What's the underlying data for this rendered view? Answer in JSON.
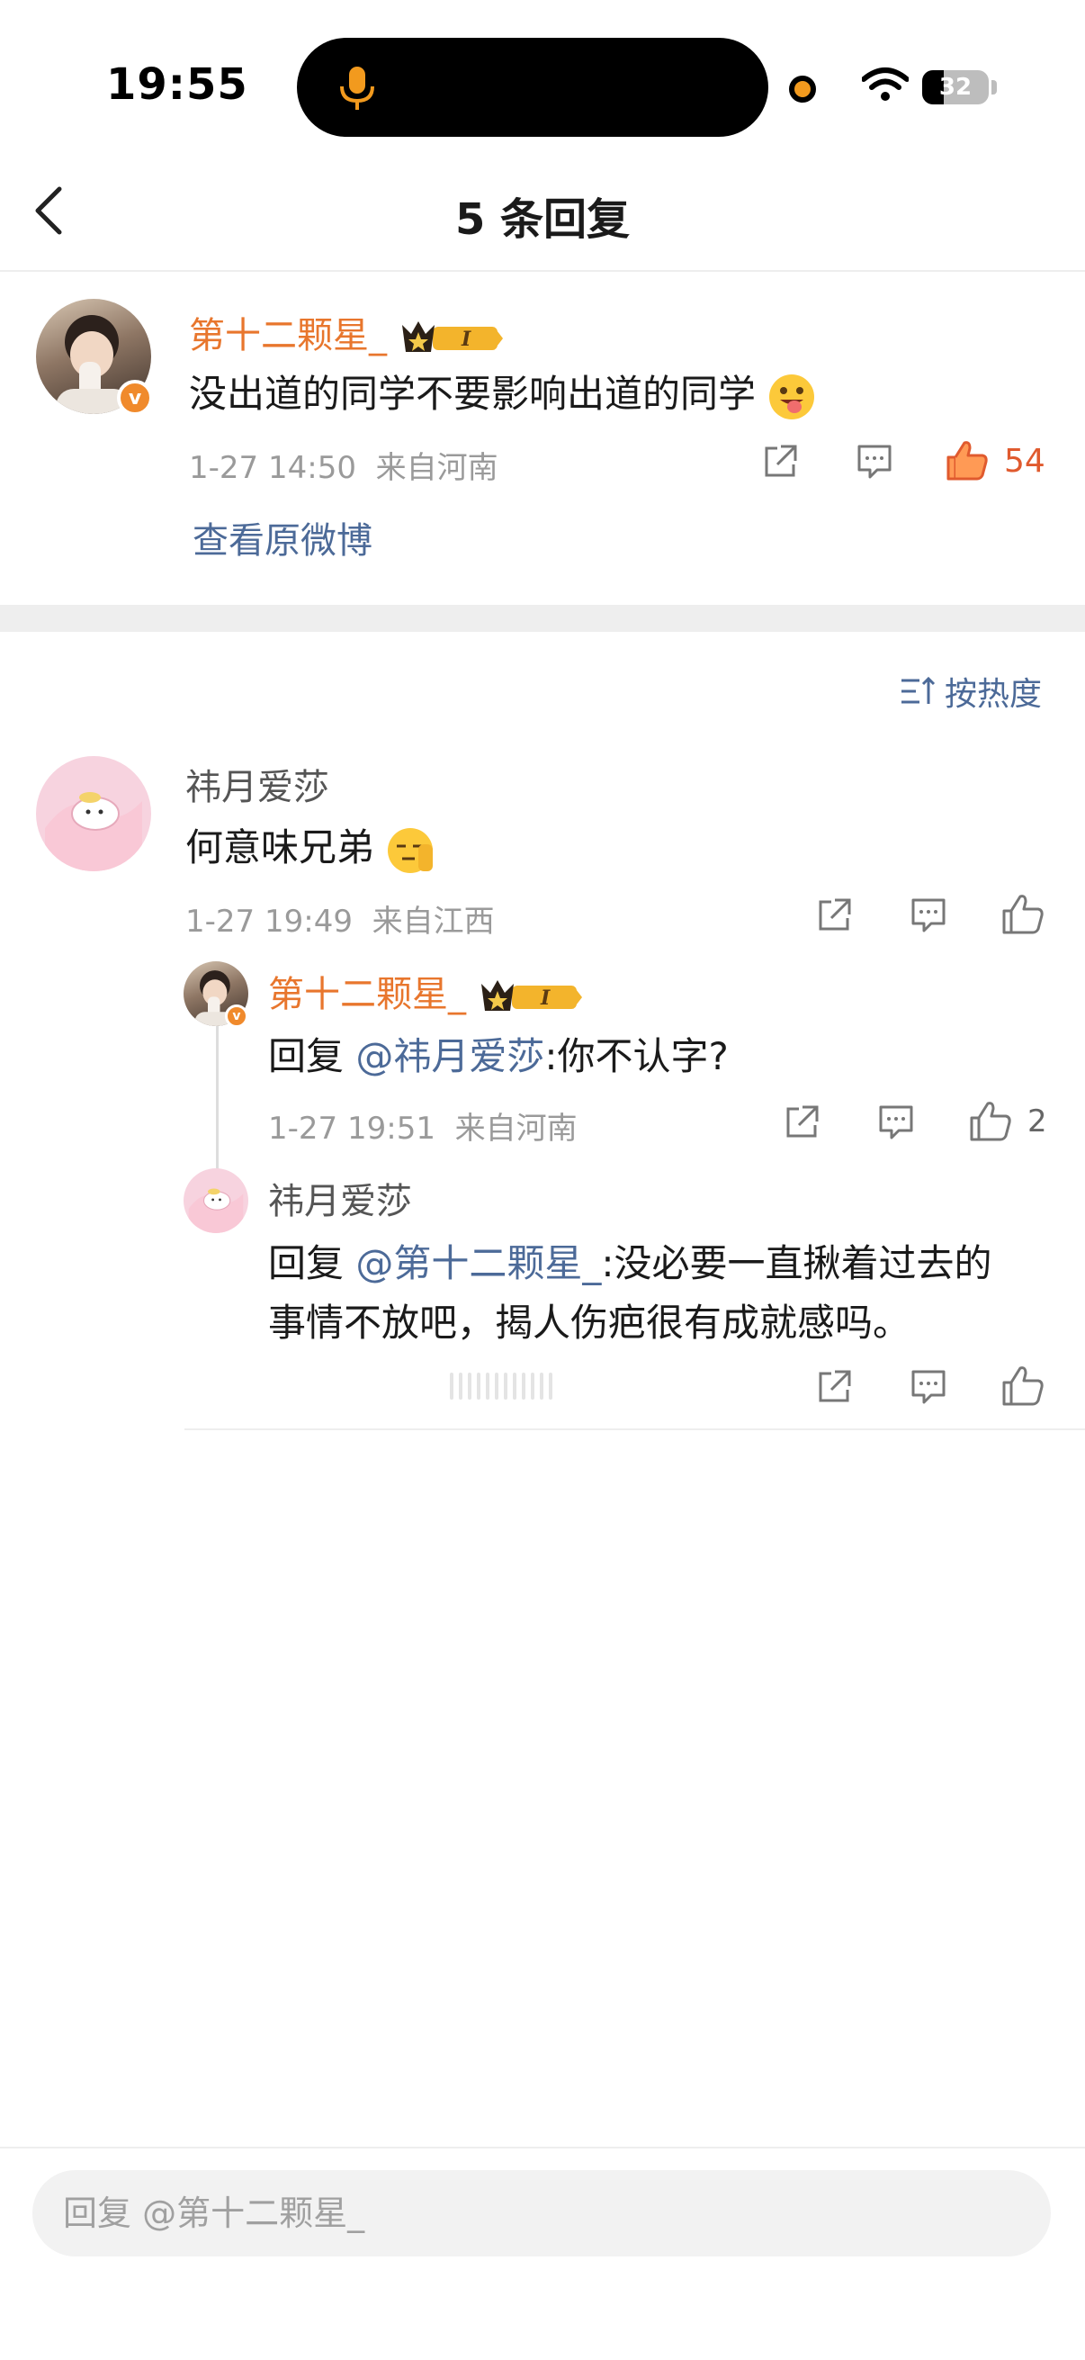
{
  "status_bar": {
    "time": "19:55",
    "battery_level": "32",
    "battery_fraction": 0.32
  },
  "nav": {
    "title": "5 条回复"
  },
  "post": {
    "username": "第十二颗星_",
    "text": "没出道的同学不要影响出道的同学",
    "date": "1-27 14:50",
    "location": "来自河南",
    "like_count": "54",
    "view_original": "查看原微博"
  },
  "sort": {
    "label": "按热度"
  },
  "comments": [
    {
      "username": "祎月爱莎",
      "text": "何意味兄弟",
      "date": "1-27 19:49",
      "location": "来自江西"
    }
  ],
  "replies": [
    {
      "username": "第十二颗星_",
      "prefix": "回复",
      "mention": "@祎月爱莎",
      "text": ":你不认字?",
      "date": "1-27 19:51",
      "location": "来自河南",
      "like_count": "2"
    },
    {
      "username": "祎月爱莎",
      "prefix": "回复",
      "mention": "@第十二颗星_",
      "text_line1": ":没必要一直揪着过去的",
      "text_line2": "事情不放吧，揭人伤疤很有成就感吗。"
    }
  ],
  "reply_box": {
    "placeholder": "回复 @第十二颗星_"
  },
  "icons": {
    "badge_letter": "I",
    "verified_letter": "v"
  },
  "colors": {
    "accent_orange": "#e8762d",
    "link_blue": "#4c6a98",
    "like_red": "#e05a2e"
  }
}
